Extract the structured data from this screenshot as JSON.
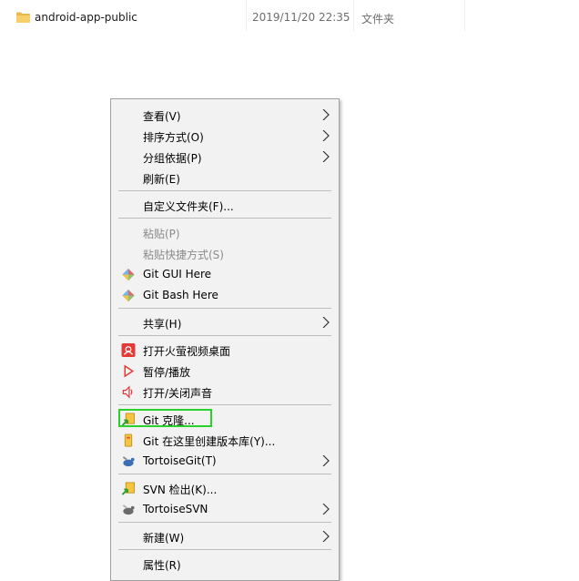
{
  "file": {
    "name": "android-app-public",
    "date": "2019/11/20 22:35",
    "type": "文件夹",
    "icon": "folder-icon"
  },
  "menu": {
    "items": {
      "view": {
        "label": "查看(V)"
      },
      "sort": {
        "label": "排序方式(O)"
      },
      "group": {
        "label": "分组依据(P)"
      },
      "refresh": {
        "label": "刷新(E)"
      },
      "customize": {
        "label": "自定义文件夹(F)..."
      },
      "paste": {
        "label": "粘贴(P)",
        "disabled": true
      },
      "paste_shortcut": {
        "label": "粘贴快捷方式(S)",
        "disabled": true
      },
      "git_gui": {
        "label": "Git GUI Here",
        "icon": "git-gui-icon"
      },
      "git_bash": {
        "label": "Git Bash Here",
        "icon": "git-bash-icon"
      },
      "share": {
        "label": "共享(H)"
      },
      "firefly_desktop": {
        "label": "打开火萤视频桌面",
        "icon": "firefly-icon"
      },
      "pause_play": {
        "label": "暂停/播放",
        "icon": "play-icon"
      },
      "toggle_sound": {
        "label": "打开/关闭声音",
        "icon": "speaker-icon"
      },
      "git_clone": {
        "label": "Git 克隆...",
        "icon": "git-clone-icon",
        "highlighted": true
      },
      "git_create_repo": {
        "label": "Git 在这里创建版本库(Y)...",
        "icon": "git-repo-icon"
      },
      "tortoisegit": {
        "label": "TortoiseGit(T)",
        "icon": "tortoisegit-icon"
      },
      "svn_checkout": {
        "label": "SVN 检出(K)...",
        "icon": "svn-checkout-icon"
      },
      "tortoisesvn": {
        "label": "TortoiseSVN",
        "icon": "tortoisesvn-icon"
      },
      "new": {
        "label": "新建(W)"
      },
      "properties": {
        "label": "属性(R)"
      }
    }
  },
  "colors": {
    "menu_bg": "#f2f2f2",
    "highlight_border": "#2bd12b",
    "disabled_text": "#8a8a8a"
  }
}
